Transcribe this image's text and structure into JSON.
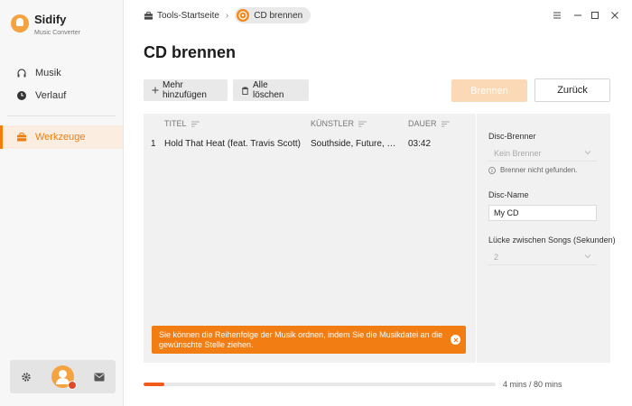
{
  "app": {
    "name": "Sidify",
    "subtitle": "Music Converter"
  },
  "sidebar": {
    "items": [
      {
        "label": "Musik",
        "icon": "headphones-icon"
      },
      {
        "label": "Verlauf",
        "icon": "clock-icon"
      },
      {
        "label": "Werkzeuge",
        "icon": "toolbox-icon",
        "active": true
      }
    ],
    "footer_icons": [
      "gear-icon",
      "avatar",
      "mail-icon"
    ]
  },
  "breadcrumb": {
    "home": "Tools-Startseite",
    "current": "CD brennen"
  },
  "window_controls": [
    "menu-icon",
    "minimize-icon",
    "maximize-icon",
    "close-icon"
  ],
  "page": {
    "title": "CD brennen"
  },
  "toolbar": {
    "add_label": "Mehr hinzufügen",
    "clear_label": "Alle löschen",
    "burn_label": "Brennen",
    "back_label": "Zurück"
  },
  "table": {
    "columns": [
      "TITEL",
      "KÜNSTLER",
      "DAUER"
    ],
    "rows": [
      {
        "index": "1",
        "title": "Hold That Heat (feat. Travis Scott)",
        "artist": "Southside, Future, Travis Scott",
        "duration": "03:42"
      }
    ]
  },
  "tip": {
    "text": "Sie können die Reihenfolge der Musik ordnen, indem Sie die Musikdatei an die gewünschte Stelle ziehen."
  },
  "settings": {
    "burner_label": "Disc-Brenner",
    "burner_value": "Kein Brenner",
    "burner_hint": "Brenner nicht gefunden.",
    "disc_name_label": "Disc-Name",
    "disc_name_value": "My CD",
    "gap_label": "Lücke zwischen Songs (Sekunden)",
    "gap_value": "2"
  },
  "progress": {
    "used_mins": 4,
    "total_mins": 80,
    "text": "4 mins / 80 mins"
  },
  "colors": {
    "accent": "#f27d13",
    "burn_disabled": "#fbd9b6",
    "progress": "#f25a1a"
  }
}
